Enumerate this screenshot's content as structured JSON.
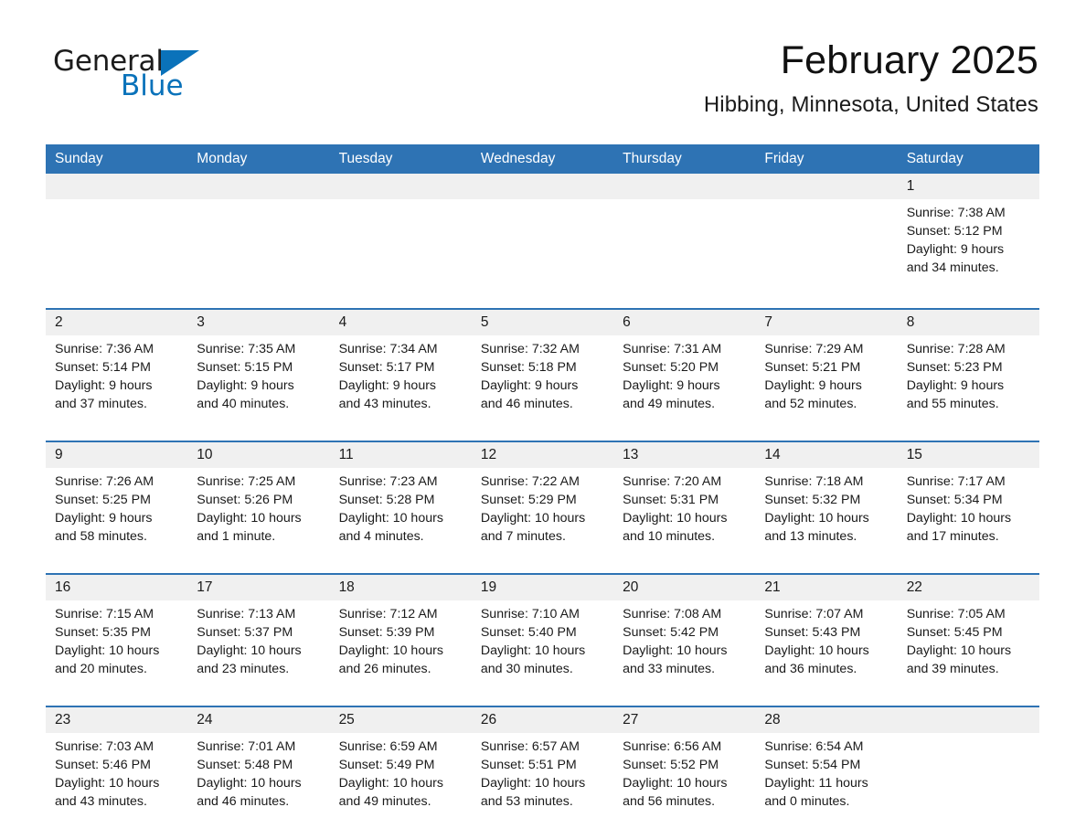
{
  "brand": {
    "name_part1": "General",
    "name_part2": "Blue",
    "accent_color": "#0a72ba"
  },
  "header": {
    "month_title": "February 2025",
    "location": "Hibbing, Minnesota, United States"
  },
  "colors": {
    "header_blue": "#2e73b4",
    "daynum_band": "#f0f0f0",
    "text": "#1a1a1a"
  },
  "weekday_headers": [
    "Sunday",
    "Monday",
    "Tuesday",
    "Wednesday",
    "Thursday",
    "Friday",
    "Saturday"
  ],
  "weeks": [
    [
      {
        "day": "",
        "empty": true,
        "sunrise": "",
        "sunset": "",
        "daylight_line1": "",
        "daylight_line2": ""
      },
      {
        "day": "",
        "empty": true,
        "sunrise": "",
        "sunset": "",
        "daylight_line1": "",
        "daylight_line2": ""
      },
      {
        "day": "",
        "empty": true,
        "sunrise": "",
        "sunset": "",
        "daylight_line1": "",
        "daylight_line2": ""
      },
      {
        "day": "",
        "empty": true,
        "sunrise": "",
        "sunset": "",
        "daylight_line1": "",
        "daylight_line2": ""
      },
      {
        "day": "",
        "empty": true,
        "sunrise": "",
        "sunset": "",
        "daylight_line1": "",
        "daylight_line2": ""
      },
      {
        "day": "",
        "empty": true,
        "sunrise": "",
        "sunset": "",
        "daylight_line1": "",
        "daylight_line2": ""
      },
      {
        "day": "1",
        "empty": false,
        "sunrise": "Sunrise: 7:38 AM",
        "sunset": "Sunset: 5:12 PM",
        "daylight_line1": "Daylight: 9 hours",
        "daylight_line2": "and 34 minutes."
      }
    ],
    [
      {
        "day": "2",
        "empty": false,
        "sunrise": "Sunrise: 7:36 AM",
        "sunset": "Sunset: 5:14 PM",
        "daylight_line1": "Daylight: 9 hours",
        "daylight_line2": "and 37 minutes."
      },
      {
        "day": "3",
        "empty": false,
        "sunrise": "Sunrise: 7:35 AM",
        "sunset": "Sunset: 5:15 PM",
        "daylight_line1": "Daylight: 9 hours",
        "daylight_line2": "and 40 minutes."
      },
      {
        "day": "4",
        "empty": false,
        "sunrise": "Sunrise: 7:34 AM",
        "sunset": "Sunset: 5:17 PM",
        "daylight_line1": "Daylight: 9 hours",
        "daylight_line2": "and 43 minutes."
      },
      {
        "day": "5",
        "empty": false,
        "sunrise": "Sunrise: 7:32 AM",
        "sunset": "Sunset: 5:18 PM",
        "daylight_line1": "Daylight: 9 hours",
        "daylight_line2": "and 46 minutes."
      },
      {
        "day": "6",
        "empty": false,
        "sunrise": "Sunrise: 7:31 AM",
        "sunset": "Sunset: 5:20 PM",
        "daylight_line1": "Daylight: 9 hours",
        "daylight_line2": "and 49 minutes."
      },
      {
        "day": "7",
        "empty": false,
        "sunrise": "Sunrise: 7:29 AM",
        "sunset": "Sunset: 5:21 PM",
        "daylight_line1": "Daylight: 9 hours",
        "daylight_line2": "and 52 minutes."
      },
      {
        "day": "8",
        "empty": false,
        "sunrise": "Sunrise: 7:28 AM",
        "sunset": "Sunset: 5:23 PM",
        "daylight_line1": "Daylight: 9 hours",
        "daylight_line2": "and 55 minutes."
      }
    ],
    [
      {
        "day": "9",
        "empty": false,
        "sunrise": "Sunrise: 7:26 AM",
        "sunset": "Sunset: 5:25 PM",
        "daylight_line1": "Daylight: 9 hours",
        "daylight_line2": "and 58 minutes."
      },
      {
        "day": "10",
        "empty": false,
        "sunrise": "Sunrise: 7:25 AM",
        "sunset": "Sunset: 5:26 PM",
        "daylight_line1": "Daylight: 10 hours",
        "daylight_line2": "and 1 minute."
      },
      {
        "day": "11",
        "empty": false,
        "sunrise": "Sunrise: 7:23 AM",
        "sunset": "Sunset: 5:28 PM",
        "daylight_line1": "Daylight: 10 hours",
        "daylight_line2": "and 4 minutes."
      },
      {
        "day": "12",
        "empty": false,
        "sunrise": "Sunrise: 7:22 AM",
        "sunset": "Sunset: 5:29 PM",
        "daylight_line1": "Daylight: 10 hours",
        "daylight_line2": "and 7 minutes."
      },
      {
        "day": "13",
        "empty": false,
        "sunrise": "Sunrise: 7:20 AM",
        "sunset": "Sunset: 5:31 PM",
        "daylight_line1": "Daylight: 10 hours",
        "daylight_line2": "and 10 minutes."
      },
      {
        "day": "14",
        "empty": false,
        "sunrise": "Sunrise: 7:18 AM",
        "sunset": "Sunset: 5:32 PM",
        "daylight_line1": "Daylight: 10 hours",
        "daylight_line2": "and 13 minutes."
      },
      {
        "day": "15",
        "empty": false,
        "sunrise": "Sunrise: 7:17 AM",
        "sunset": "Sunset: 5:34 PM",
        "daylight_line1": "Daylight: 10 hours",
        "daylight_line2": "and 17 minutes."
      }
    ],
    [
      {
        "day": "16",
        "empty": false,
        "sunrise": "Sunrise: 7:15 AM",
        "sunset": "Sunset: 5:35 PM",
        "daylight_line1": "Daylight: 10 hours",
        "daylight_line2": "and 20 minutes."
      },
      {
        "day": "17",
        "empty": false,
        "sunrise": "Sunrise: 7:13 AM",
        "sunset": "Sunset: 5:37 PM",
        "daylight_line1": "Daylight: 10 hours",
        "daylight_line2": "and 23 minutes."
      },
      {
        "day": "18",
        "empty": false,
        "sunrise": "Sunrise: 7:12 AM",
        "sunset": "Sunset: 5:39 PM",
        "daylight_line1": "Daylight: 10 hours",
        "daylight_line2": "and 26 minutes."
      },
      {
        "day": "19",
        "empty": false,
        "sunrise": "Sunrise: 7:10 AM",
        "sunset": "Sunset: 5:40 PM",
        "daylight_line1": "Daylight: 10 hours",
        "daylight_line2": "and 30 minutes."
      },
      {
        "day": "20",
        "empty": false,
        "sunrise": "Sunrise: 7:08 AM",
        "sunset": "Sunset: 5:42 PM",
        "daylight_line1": "Daylight: 10 hours",
        "daylight_line2": "and 33 minutes."
      },
      {
        "day": "21",
        "empty": false,
        "sunrise": "Sunrise: 7:07 AM",
        "sunset": "Sunset: 5:43 PM",
        "daylight_line1": "Daylight: 10 hours",
        "daylight_line2": "and 36 minutes."
      },
      {
        "day": "22",
        "empty": false,
        "sunrise": "Sunrise: 7:05 AM",
        "sunset": "Sunset: 5:45 PM",
        "daylight_line1": "Daylight: 10 hours",
        "daylight_line2": "and 39 minutes."
      }
    ],
    [
      {
        "day": "23",
        "empty": false,
        "sunrise": "Sunrise: 7:03 AM",
        "sunset": "Sunset: 5:46 PM",
        "daylight_line1": "Daylight: 10 hours",
        "daylight_line2": "and 43 minutes."
      },
      {
        "day": "24",
        "empty": false,
        "sunrise": "Sunrise: 7:01 AM",
        "sunset": "Sunset: 5:48 PM",
        "daylight_line1": "Daylight: 10 hours",
        "daylight_line2": "and 46 minutes."
      },
      {
        "day": "25",
        "empty": false,
        "sunrise": "Sunrise: 6:59 AM",
        "sunset": "Sunset: 5:49 PM",
        "daylight_line1": "Daylight: 10 hours",
        "daylight_line2": "and 49 minutes."
      },
      {
        "day": "26",
        "empty": false,
        "sunrise": "Sunrise: 6:57 AM",
        "sunset": "Sunset: 5:51 PM",
        "daylight_line1": "Daylight: 10 hours",
        "daylight_line2": "and 53 minutes."
      },
      {
        "day": "27",
        "empty": false,
        "sunrise": "Sunrise: 6:56 AM",
        "sunset": "Sunset: 5:52 PM",
        "daylight_line1": "Daylight: 10 hours",
        "daylight_line2": "and 56 minutes."
      },
      {
        "day": "28",
        "empty": false,
        "sunrise": "Sunrise: 6:54 AM",
        "sunset": "Sunset: 5:54 PM",
        "daylight_line1": "Daylight: 11 hours",
        "daylight_line2": "and 0 minutes."
      },
      {
        "day": "",
        "empty": true,
        "sunrise": "",
        "sunset": "",
        "daylight_line1": "",
        "daylight_line2": ""
      }
    ]
  ]
}
